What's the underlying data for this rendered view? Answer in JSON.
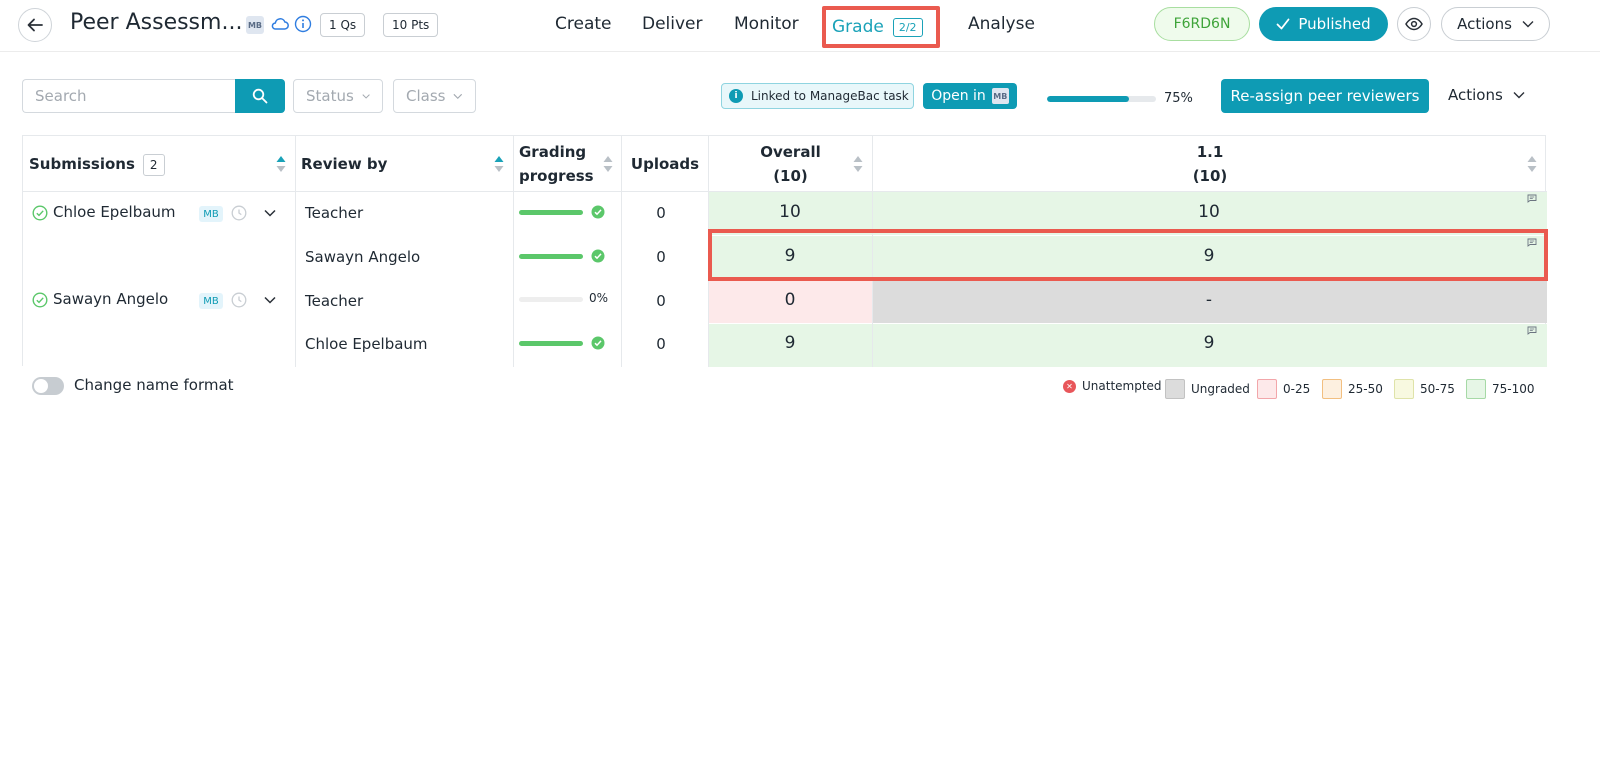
{
  "header": {
    "title": "Peer Assessm...",
    "mb_chip": "MB",
    "questions_pill": "1 Qs",
    "points_pill": "10 Pts",
    "nav": {
      "create": "Create",
      "deliver": "Deliver",
      "monitor": "Monitor",
      "grade": "Grade",
      "grade_badge": "2/2",
      "analyse": "Analyse"
    },
    "code": "F6RD6N",
    "published": "Published",
    "actions": "Actions"
  },
  "toolbar": {
    "search_placeholder": "Search",
    "status_filter": "Status",
    "class_filter": "Class",
    "linked_label": "Linked to ManageBac task",
    "open_in_label": "Open in",
    "open_in_chip": "MB",
    "progress_percent": 75,
    "progress_label": "75%",
    "reassign_label": "Re-assign peer reviewers",
    "actions_label": "Actions"
  },
  "table": {
    "headers": {
      "submissions": "Submissions",
      "submissions_count": "2",
      "review_by": "Review by",
      "grading_progress_l1": "Grading",
      "grading_progress_l2": "progress",
      "uploads": "Uploads",
      "overall_l1": "Overall",
      "overall_l2": "(10)",
      "q11_l1": "1.1",
      "q11_l2": "(10)"
    },
    "students": [
      {
        "name": "Chloe Epelbaum",
        "tag": "MB"
      },
      {
        "name": "Sawayn Angelo",
        "tag": "MB"
      }
    ],
    "rows": [
      {
        "reviewer": "Teacher",
        "progress": 100,
        "progress_label": "",
        "uploads": "0",
        "overall": "10",
        "q11": "10"
      },
      {
        "reviewer": "Sawayn Angelo",
        "progress": 100,
        "progress_label": "",
        "uploads": "0",
        "overall": "9",
        "q11": "9"
      },
      {
        "reviewer": "Teacher",
        "progress": 0,
        "progress_label": "0%",
        "uploads": "0",
        "overall": "0",
        "q11": "-"
      },
      {
        "reviewer": "Chloe Epelbaum",
        "progress": 100,
        "progress_label": "",
        "uploads": "0",
        "overall": "9",
        "q11": "9"
      }
    ]
  },
  "footer": {
    "toggle_label": "Change name format",
    "legend": {
      "unattempted": "Unattempted",
      "ungraded": "Ungraded",
      "r0": "0-25",
      "r1": "25-50",
      "r2": "50-75",
      "r3": "75-100"
    }
  },
  "colors": {
    "accent": "#0e9bb4",
    "highlight": "#ea5a4f",
    "graded_green": "#e6f6e6",
    "low_pink": "#fde9ea",
    "ungraded_grey": "#dcdcdc"
  },
  "icons": [
    "arrow-left-icon",
    "cloud-icon",
    "info-icon",
    "check-icon",
    "eye-icon",
    "chevron-down-icon",
    "search-icon",
    "sort-icon",
    "check-circle-icon",
    "clock-icon",
    "comment-icon",
    "x-circle-icon"
  ]
}
